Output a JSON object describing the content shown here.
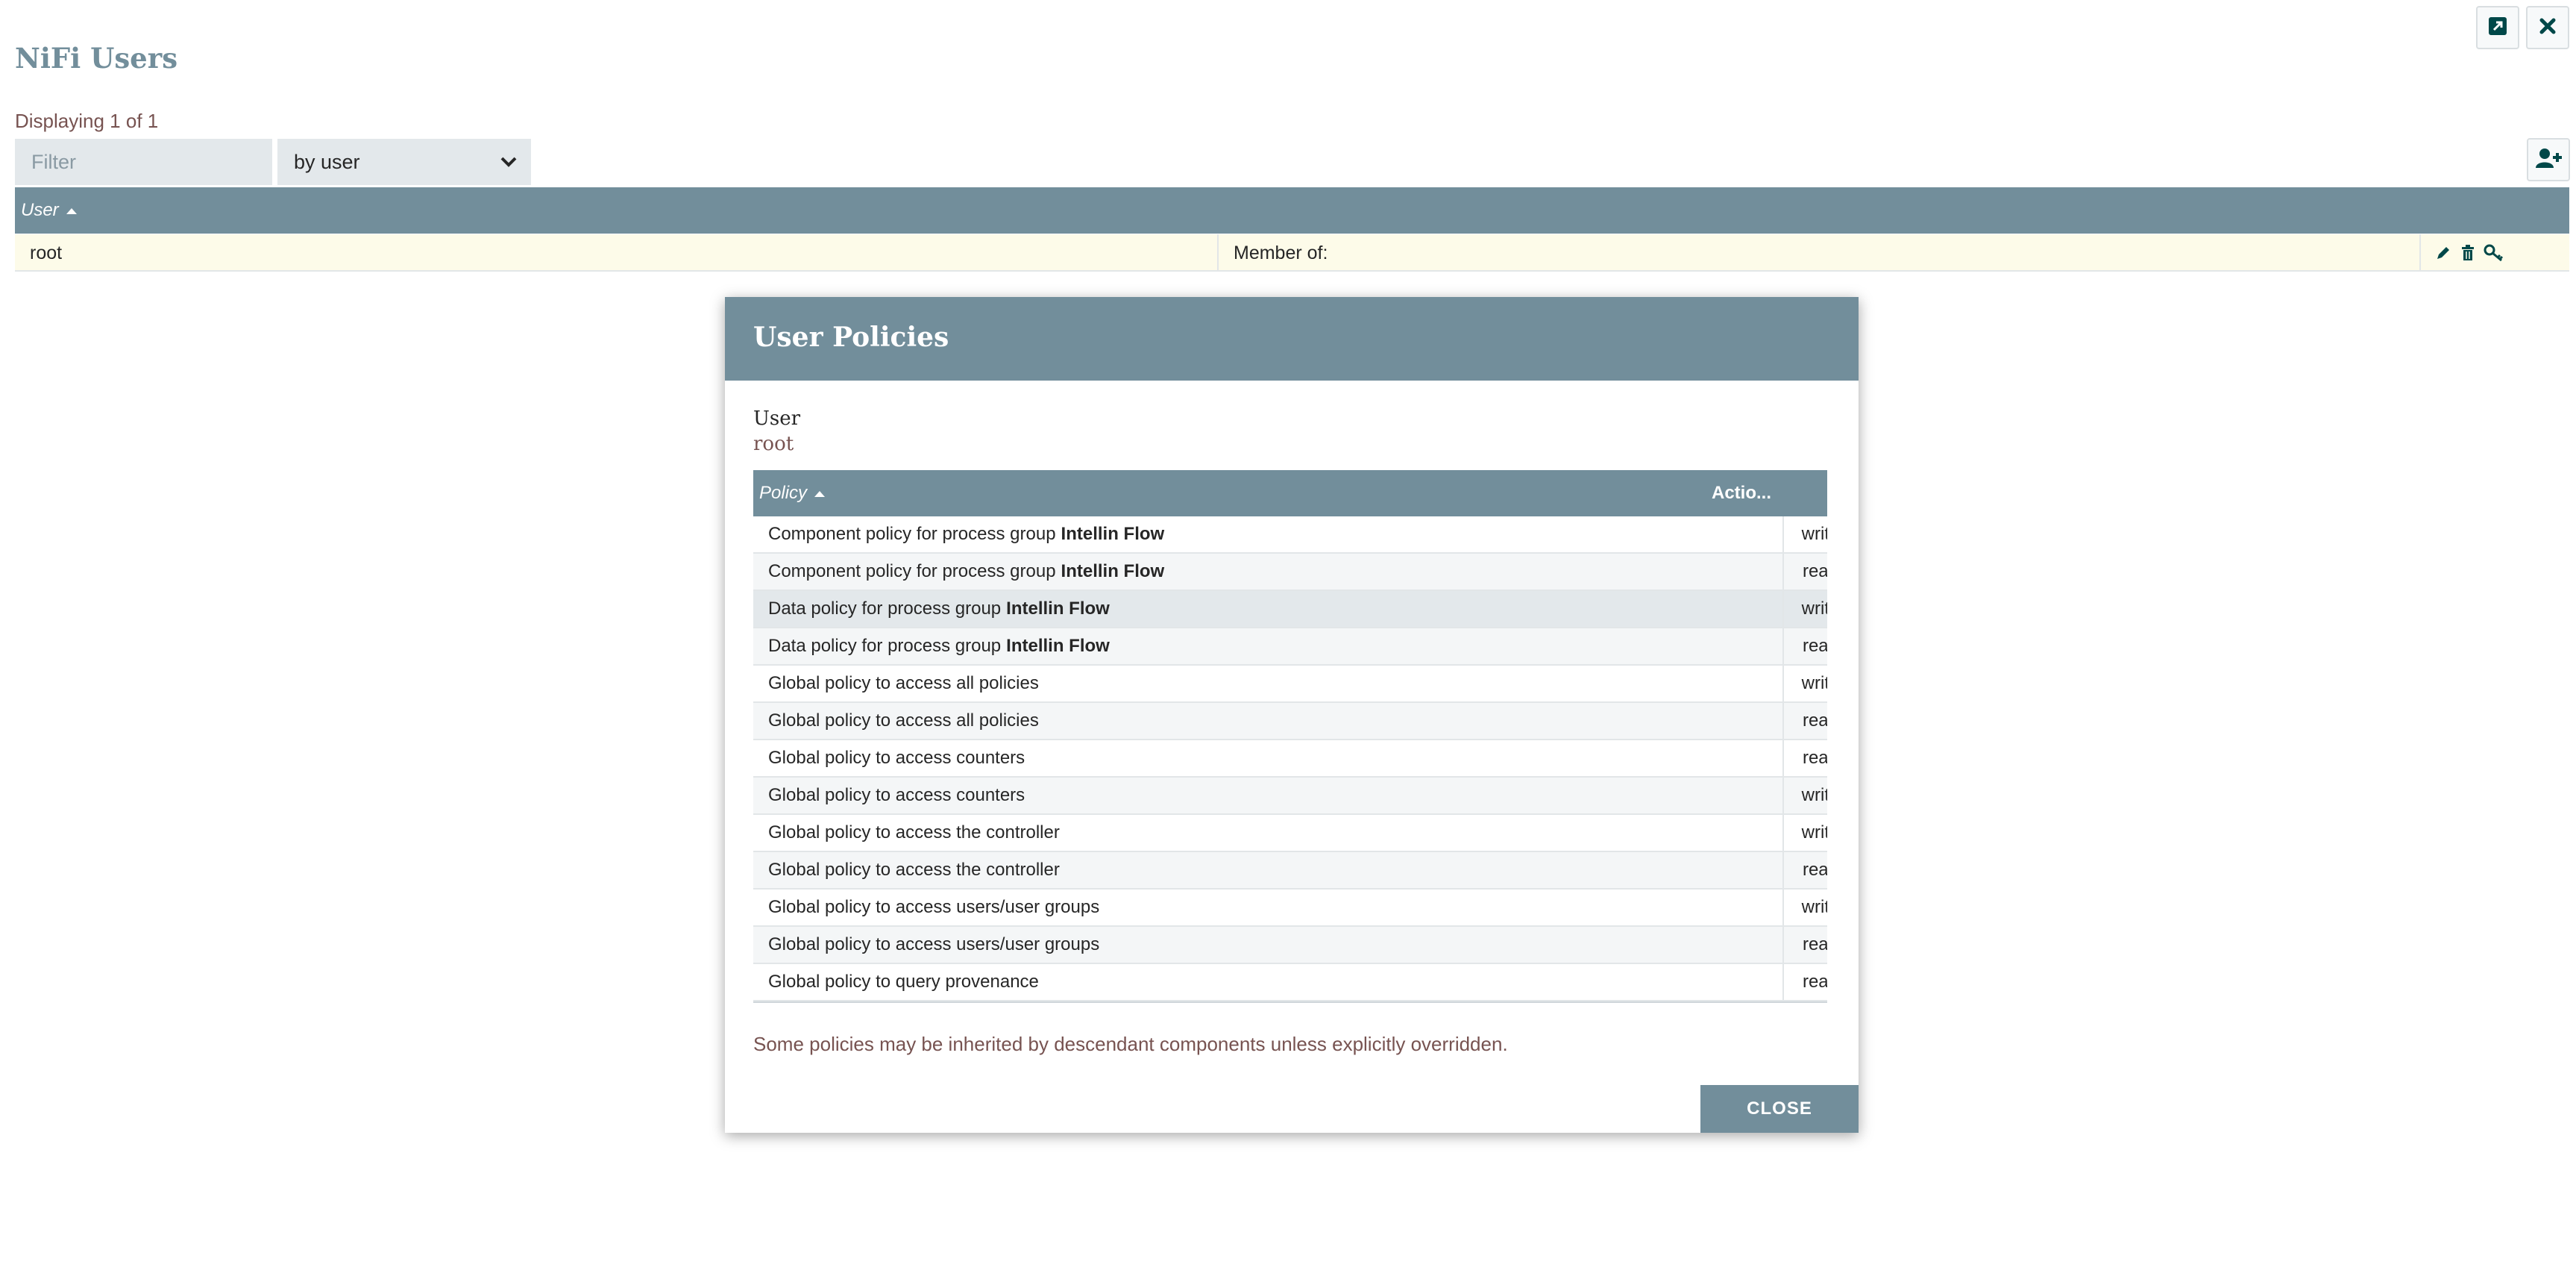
{
  "window": {
    "popout_icon": "external-link-icon",
    "close_icon": "close-icon"
  },
  "page": {
    "title": "NiFi Users",
    "displaying": "Displaying 1 of 1"
  },
  "filter": {
    "placeholder": "Filter",
    "value": "",
    "mode": "by user"
  },
  "users_table": {
    "column_user": "User",
    "rows": [
      {
        "user": "root",
        "member_of": "Member of:"
      }
    ]
  },
  "dialog": {
    "title": "User Policies",
    "user_label": "User",
    "user_value": "root",
    "col_policy": "Policy",
    "col_action": "Actio...",
    "rows": [
      {
        "text": "Component policy for process group",
        "bold": "Intellin Flow",
        "action": "write",
        "goto": true
      },
      {
        "text": "Component policy for process group",
        "bold": "Intellin Flow",
        "action": "read",
        "goto": true
      },
      {
        "text": "Data policy for process group",
        "bold": "Intellin Flow",
        "action": "write",
        "goto": true
      },
      {
        "text": "Data policy for process group",
        "bold": "Intellin Flow",
        "action": "read",
        "goto": true
      },
      {
        "text": "Global policy to access all policies",
        "bold": "",
        "action": "write",
        "goto": false
      },
      {
        "text": "Global policy to access all policies",
        "bold": "",
        "action": "read",
        "goto": false
      },
      {
        "text": "Global policy to access counters",
        "bold": "",
        "action": "read",
        "goto": false
      },
      {
        "text": "Global policy to access counters",
        "bold": "",
        "action": "write",
        "goto": false
      },
      {
        "text": "Global policy to access the controller",
        "bold": "",
        "action": "write",
        "goto": false
      },
      {
        "text": "Global policy to access the controller",
        "bold": "",
        "action": "read",
        "goto": false
      },
      {
        "text": "Global policy to access users/user groups",
        "bold": "",
        "action": "write",
        "goto": false
      },
      {
        "text": "Global policy to access users/user groups",
        "bold": "",
        "action": "read",
        "goto": false
      },
      {
        "text": "Global policy to query provenance",
        "bold": "",
        "action": "read",
        "goto": false
      }
    ],
    "note": "Some policies may be inherited by descendant components unless explicitly overridden.",
    "close_label": "CLOSE"
  },
  "colors": {
    "header": "#728e9b",
    "accent_text": "#775351",
    "selected_row": "#fdfbe9"
  }
}
